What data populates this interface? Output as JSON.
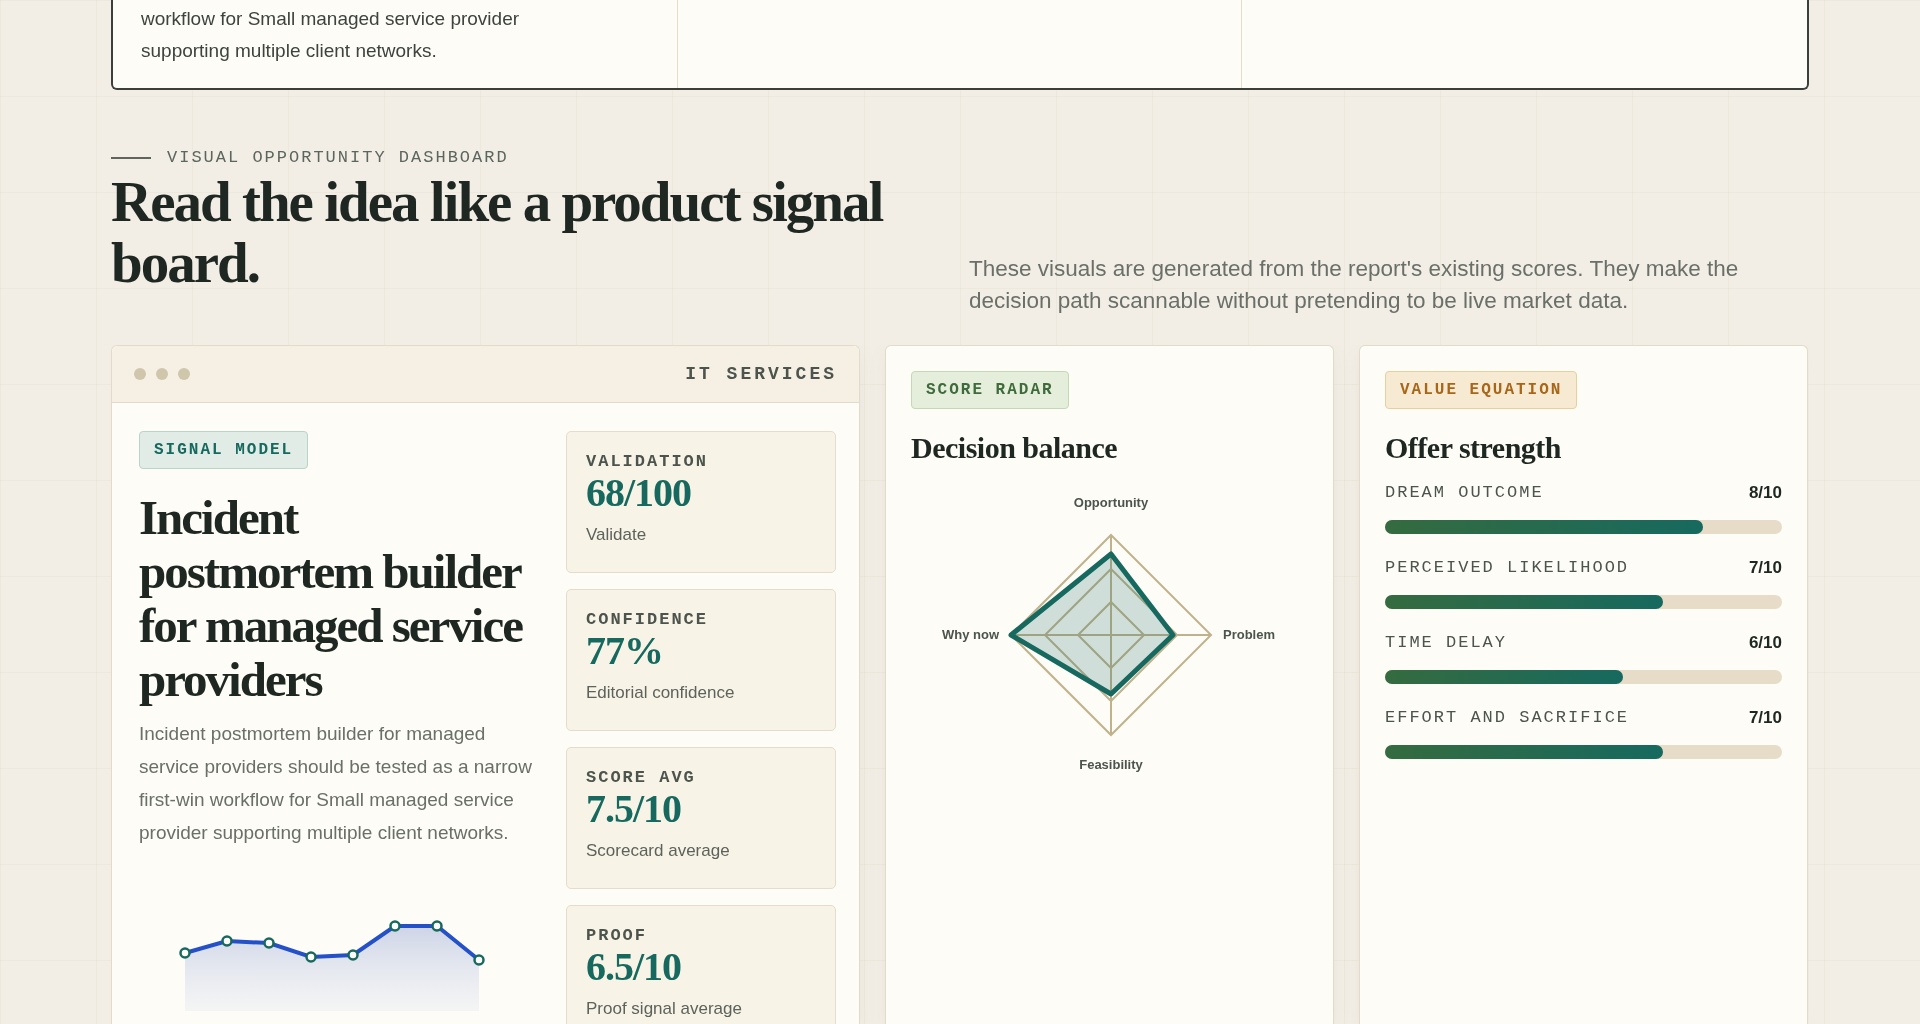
{
  "top_card": {
    "summary": "workflow for Small managed service provider supporting multiple client networks."
  },
  "section": {
    "eyebrow": "VISUAL OPPORTUNITY DASHBOARD",
    "heading": "Read the idea like a product signal board.",
    "description": "These visuals are generated from the report's existing scores. They make the decision path scannable without pretending to be live market data."
  },
  "signal_card": {
    "category": "IT SERVICES",
    "badge": "SIGNAL MODEL",
    "title": "Incident postmortem builder for managed service providers",
    "body": "Incident postmortem builder for managed service providers should be tested as a narrow first-win workflow for Small managed service provider supporting multiple client networks.",
    "metrics": [
      {
        "label": "VALIDATION",
        "value": "68/100",
        "caption": "Validate"
      },
      {
        "label": "CONFIDENCE",
        "value": "77%",
        "caption": "Editorial confidence"
      },
      {
        "label": "SCORE AVG",
        "value": "7.5/10",
        "caption": "Scorecard average"
      },
      {
        "label": "PROOF",
        "value": "6.5/10",
        "caption": "Proof signal average"
      }
    ]
  },
  "radar_card": {
    "badge": "SCORE RADAR",
    "title": "Decision balance",
    "axes": [
      "Opportunity",
      "Problem",
      "Feasibility",
      "Why now"
    ]
  },
  "value_card": {
    "badge": "VALUE EQUATION",
    "title": "Offer strength",
    "bars": [
      {
        "label": "DREAM OUTCOME",
        "reading": "8/10",
        "level": 0.8
      },
      {
        "label": "PERCEIVED LIKELIHOOD",
        "reading": "7/10",
        "level": 0.7
      },
      {
        "label": "TIME DELAY",
        "reading": "6/10",
        "level": 0.6
      },
      {
        "label": "EFFORT AND SACRIFICE",
        "reading": "7/10",
        "level": 0.7
      }
    ]
  }
}
